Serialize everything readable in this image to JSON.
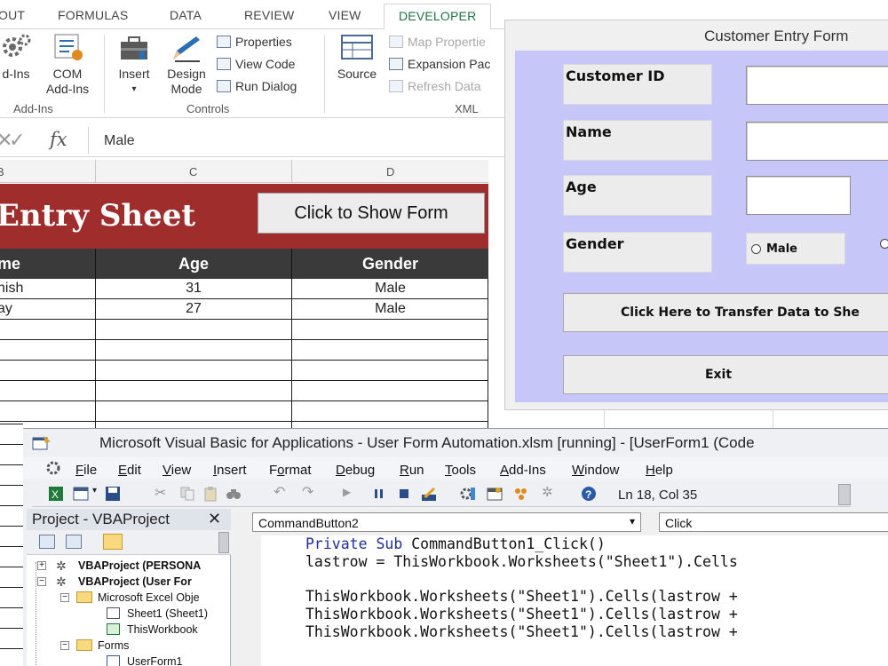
{
  "ribbon": {
    "tabs": [
      "OUT",
      "FORMULAS",
      "DATA",
      "REVIEW",
      "VIEW",
      "DEVELOPER"
    ],
    "addins_label": "Add-Ins",
    "addins_btn": "d-Ins",
    "com_label_1": "COM",
    "com_label_2": "Add-Ins",
    "insert_label": "Insert",
    "design_label_1": "Design",
    "design_label_2": "Mode",
    "properties": "Properties",
    "view_code": "View Code",
    "run_dialog": "Run Dialog",
    "controls_label": "Controls",
    "source_label": "Source",
    "map_properties": "Map Propertie",
    "expansion_packs": "Expansion Pac",
    "refresh_data": "Refresh Data",
    "xml_label": "XML"
  },
  "formula_bar": {
    "cancel": "✕",
    "confirm": "✓",
    "fx": "fx",
    "value": "Male"
  },
  "columns": {
    "b": "B",
    "c": "C",
    "d": "D"
  },
  "sheet": {
    "title": "Entry Sheet",
    "show_form_button": "Click to Show Form",
    "headers": [
      "me",
      "Age",
      "Gender"
    ],
    "rows": [
      [
        "nish",
        "31",
        "Male"
      ],
      [
        "ay",
        "27",
        "Male"
      ]
    ]
  },
  "user_form": {
    "title": "Customer Entry Form",
    "customer_id_label": "Customer ID",
    "name_label": "Name",
    "age_label": "Age",
    "gender_label": "Gender",
    "male_option": "Male",
    "transfer_button": "Click Here to Transfer Data to She",
    "exit_button": "Exit"
  },
  "vba": {
    "title": "Microsoft Visual Basic for Applications - User Form Automation.xlsm [running] - [UserForm1 (Code",
    "menus": [
      "File",
      "Edit",
      "View",
      "Insert",
      "Format",
      "Debug",
      "Run",
      "Tools",
      "Add-Ins",
      "Window",
      "Help"
    ],
    "menu_keys": [
      "F",
      "E",
      "V",
      "I",
      "o",
      "D",
      "R",
      "T",
      "A",
      "W",
      "H"
    ],
    "cursor_position": "Ln 18, Col 35",
    "project_title": "Project - VBAProject",
    "close": "✕",
    "tree": [
      "VBAProject (PERSONA",
      "VBAProject (User For",
      "Microsoft Excel Obje",
      "Sheet1 (Sheet1)",
      "ThisWorkbook",
      "Forms",
      "UserForm1"
    ],
    "object_dropdown": "CommandButton2",
    "procedure_dropdown": "Click",
    "code": {
      "l1_kw": "Private Sub",
      "l1_rest": " CommandButton1_Click()",
      "l2": "lastrow = ThisWorkbook.Worksheets(\"Sheet1\").Cells",
      "l3": "ThisWorkbook.Worksheets(\"Sheet1\").Cells(lastrow +",
      "l4": "ThisWorkbook.Worksheets(\"Sheet1\").Cells(lastrow +",
      "l5": "ThisWorkbook.Worksheets(\"Sheet1\").Cells(lastrow +"
    }
  },
  "colors": {
    "sheet_title_bg": "#9e2d2b",
    "header_bg": "#3a3a3a",
    "form_bg": "#c6c6f8",
    "developer_tab": "#217346",
    "keyword": "#1f2e9c"
  }
}
